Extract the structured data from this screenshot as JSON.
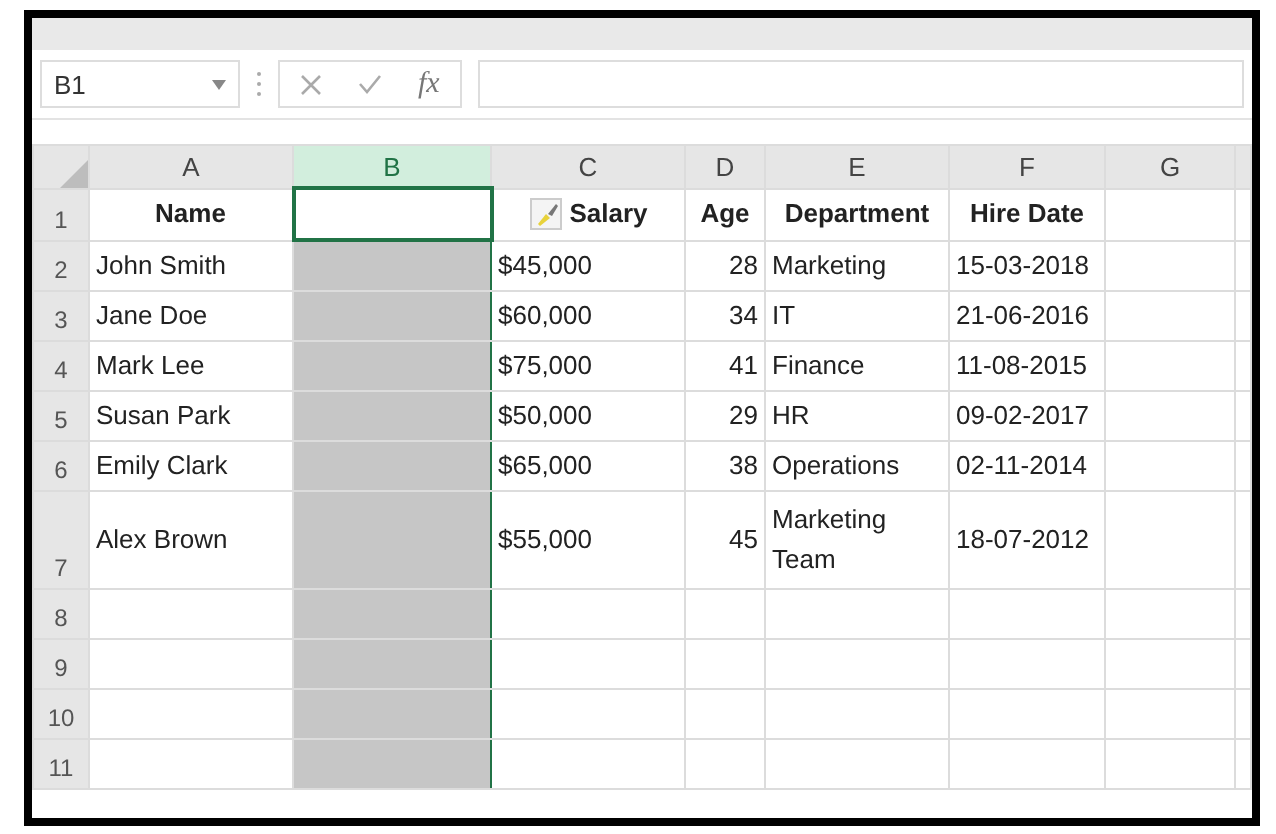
{
  "name_box": {
    "value": "B1"
  },
  "formula_bar": {
    "function_label": "fx"
  },
  "columns": [
    {
      "label": "A",
      "selected": false
    },
    {
      "label": "B",
      "selected": true
    },
    {
      "label": "C",
      "selected": false
    },
    {
      "label": "D",
      "selected": false
    },
    {
      "label": "E",
      "selected": false
    },
    {
      "label": "F",
      "selected": false
    },
    {
      "label": "G",
      "selected": false
    }
  ],
  "rows": [
    {
      "number": "1",
      "kind": "header",
      "cells": [
        "Name",
        null,
        "Salary",
        "Age",
        "Department",
        "Hire Date",
        null
      ]
    },
    {
      "number": "2",
      "kind": "data",
      "cells": [
        "John Smith",
        null,
        "$45,000",
        "28",
        "Marketing",
        "15-03-2018",
        null
      ]
    },
    {
      "number": "3",
      "kind": "data",
      "cells": [
        "Jane Doe",
        null,
        "$60,000",
        "34",
        "IT",
        "21-06-2016",
        null
      ]
    },
    {
      "number": "4",
      "kind": "data",
      "cells": [
        "Mark Lee",
        null,
        "$75,000",
        "41",
        "Finance",
        "11-08-2015",
        null
      ]
    },
    {
      "number": "5",
      "kind": "data",
      "cells": [
        "Susan Park",
        null,
        "$50,000",
        "29",
        "HR",
        "09-02-2017",
        null
      ]
    },
    {
      "number": "6",
      "kind": "data",
      "cells": [
        "Emily Clark",
        null,
        "$65,000",
        "38",
        "Operations",
        "02-11-2014",
        null
      ]
    },
    {
      "number": "7",
      "kind": "data",
      "cells": [
        "Alex Brown",
        null,
        "$55,000",
        "45",
        "Marketing Team",
        "18-07-2012",
        null
      ]
    },
    {
      "number": "8",
      "kind": "blank"
    },
    {
      "number": "9",
      "kind": "blank"
    },
    {
      "number": "10",
      "kind": "blank"
    },
    {
      "number": "11",
      "kind": "blank"
    }
  ]
}
